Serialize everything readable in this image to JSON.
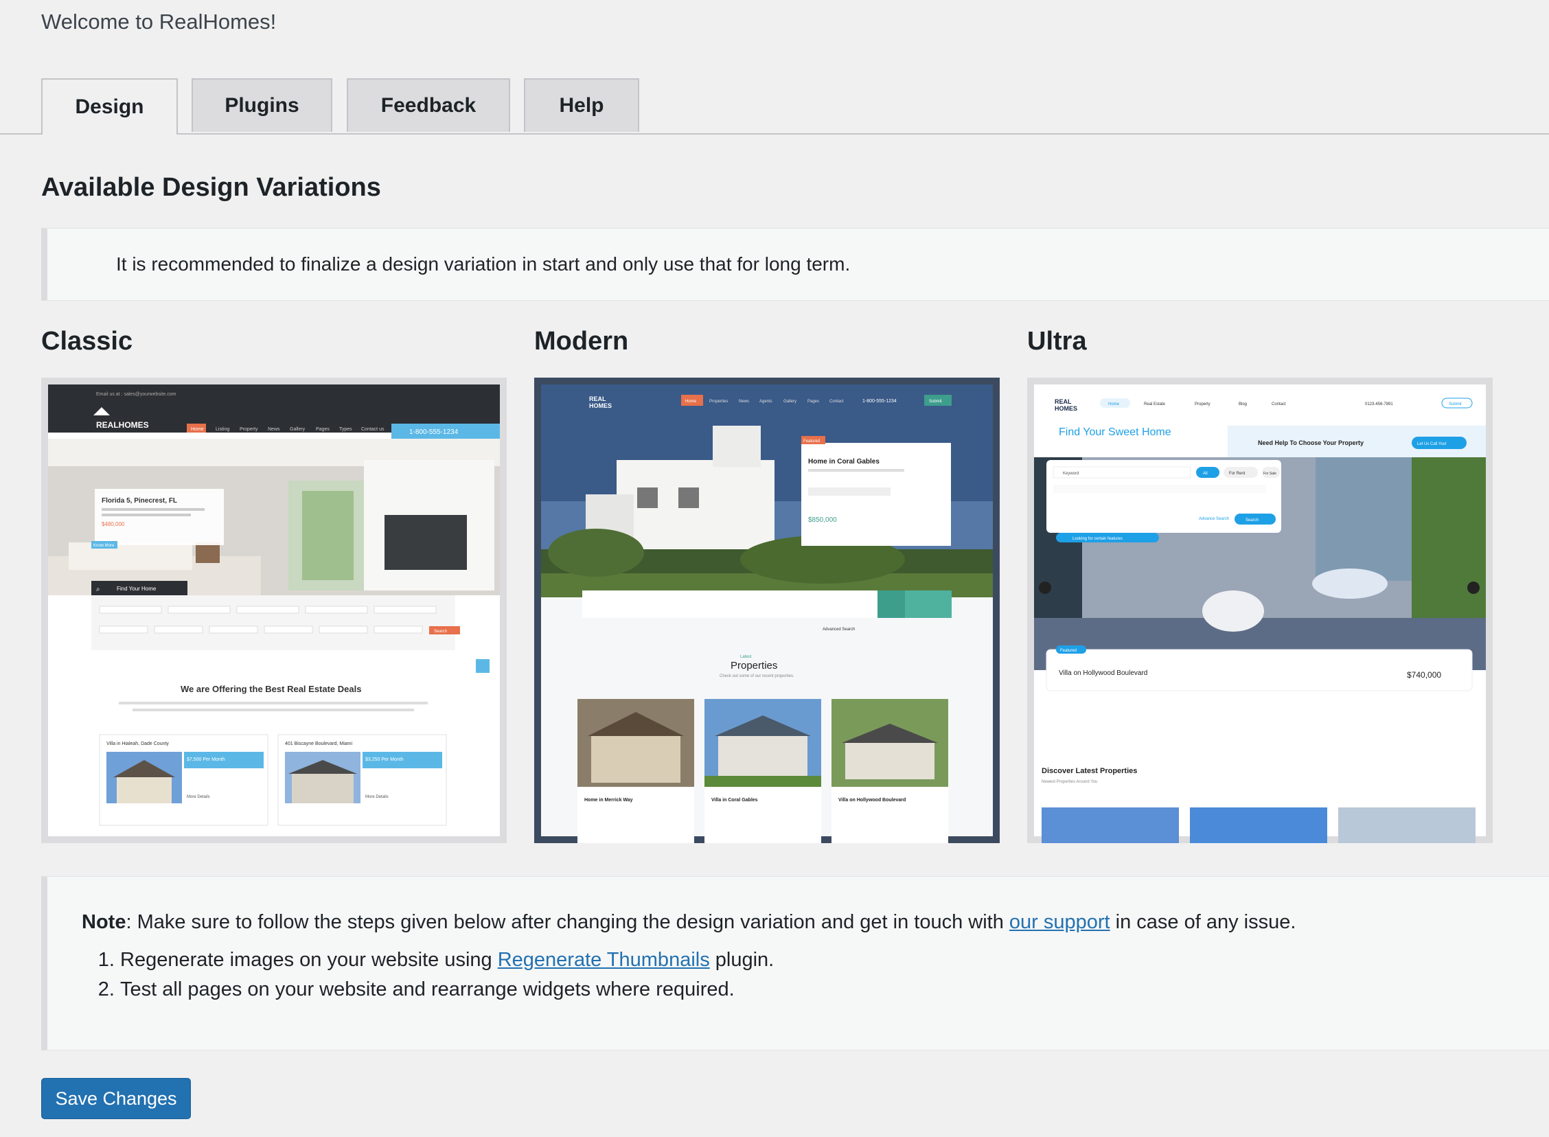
{
  "page": {
    "welcome": "Welcome to RealHomes!"
  },
  "tabs": [
    {
      "label": "Design",
      "active": true
    },
    {
      "label": "Plugins",
      "active": false
    },
    {
      "label": "Feedback",
      "active": false
    },
    {
      "label": "Help",
      "active": false
    }
  ],
  "section_title": "Available Design Variations",
  "recommendation": "It is recommended to finalize a design variation in start and only use that for long term.",
  "variations": {
    "classic": {
      "label": "Classic",
      "preview": {
        "email": "Email us at : sales@yourwebsite.com",
        "logo": "REALHOMES",
        "phone": "1-800-555-1234",
        "nav": [
          "Home",
          "Listing",
          "Property",
          "News",
          "Gallery",
          "Pages",
          "Types",
          "Contact us"
        ],
        "hero_title": "Florida 5, Pinecrest, FL",
        "hero_price": "$480,000",
        "hero_button": "Know More",
        "search_title": "Find Your Home",
        "search_button": "Search",
        "offer_title": "We are Offering the Best Real Estate Deals",
        "listing1": "Villa in Hialeah, Dade County",
        "listing1_price": "$7,500 Per Month",
        "listing2": "401 Biscayne Boulevard, Miami",
        "listing2_price": "$3,250 Per Month",
        "more_details": "More Details"
      }
    },
    "modern": {
      "label": "Modern",
      "preview": {
        "logo_line1": "REAL",
        "logo_line2": "HOMES",
        "nav": [
          "Home",
          "Properties",
          "News",
          "Agents",
          "Gallery",
          "Pages",
          "Contact"
        ],
        "phone": "1-800-555-1234",
        "submit": "Submit",
        "featured": "Featured",
        "card_title": "Home in Coral Gables",
        "card_price": "$850,000",
        "section_small": "Latest",
        "section_title": "Properties",
        "section_sub": "Check out some of our recent properties.",
        "advanced": "Advanced Search",
        "prop1": "Home in Merrick Way",
        "prop2": "Villa in Coral Gables",
        "prop3": "Villa on Hollywood Boulevard"
      }
    },
    "ultra": {
      "label": "Ultra",
      "preview": {
        "logo_line1": "REAL",
        "logo_line2": "HOMES",
        "nav": [
          "Home",
          "Real Estate",
          "Property",
          "Blog",
          "Contact"
        ],
        "phone": "0123-456-7891",
        "submit": "Submit",
        "headline": "Find Your Sweet Home",
        "help": "Need Help To Choose Your Property",
        "call": "Let Us Call You!",
        "keyword": "Keyword",
        "tabs": [
          "All",
          "For Rent",
          "For Sale"
        ],
        "advance": "Advance Search",
        "search": "Search",
        "looking": "Looking for certain features",
        "featured": "Featured",
        "card_title": "Villa on Hollywood Boulevard",
        "card_price": "$740,000",
        "discover": "Discover Latest Properties",
        "discover_sub": "Newest Properties Around You"
      }
    }
  },
  "note": {
    "label": "Note",
    "text_before": ": Make sure to follow the steps given below after changing the design variation and get in touch with ",
    "link": "our support",
    "text_after": " in case of any issue.",
    "steps": [
      {
        "before": "Regenerate images on your website using ",
        "link": "Regenerate Thumbnails",
        "after": " plugin."
      },
      {
        "before": "Test all pages on your website and rearrange widgets where required.",
        "link": "",
        "after": ""
      }
    ]
  },
  "save_button": "Save Changes",
  "colors": {
    "primary": "#2271b1",
    "classic_accent": "#e8704a",
    "modern_accent": "#3d9e8c",
    "ultra_accent": "#1ea0e6"
  }
}
